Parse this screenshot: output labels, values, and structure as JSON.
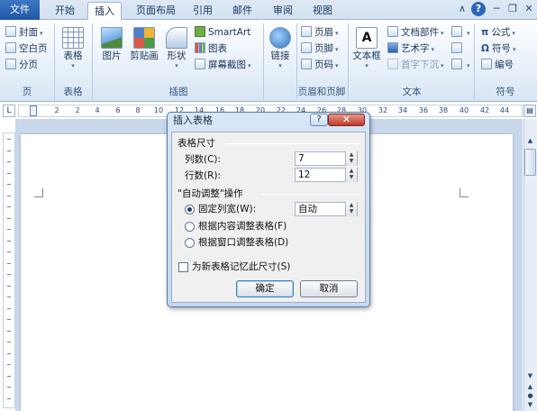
{
  "tabs": {
    "file": "文件",
    "home": "开始",
    "insert": "插入",
    "page_layout": "页面布局",
    "references": "引用",
    "mailings": "邮件",
    "review": "审阅",
    "view": "视图"
  },
  "window_controls": {
    "collapse": "∧",
    "help": "?",
    "minimize": "─",
    "restore": "❐",
    "close": "✕"
  },
  "ribbon": {
    "pages": {
      "label": "页",
      "cover": "封面",
      "blank_page": "空白页",
      "page_break": "分页"
    },
    "tables": {
      "label": "表格",
      "table": "表格"
    },
    "illustrations": {
      "label": "插图",
      "picture": "图片",
      "clip_art": "剪贴画",
      "shapes": "形状",
      "smartart": "SmartArt",
      "chart": "图表",
      "screenshot": "屏幕截图"
    },
    "links": {
      "link": "链接"
    },
    "header_footer": {
      "label": "页眉和页脚",
      "header": "页眉",
      "footer": "页脚",
      "page_number": "页码"
    },
    "text": {
      "label": "文本",
      "textbox": "文本框",
      "quick_parts": "文档部件",
      "wordart": "艺术字",
      "drop_cap": "首字下沉"
    },
    "symbols": {
      "label": "符号",
      "equation": "公式",
      "symbol": "符号",
      "number": "编号",
      "equation_glyph": "π",
      "symbol_glyph": "Ω"
    }
  },
  "ruler": {
    "corner": "L",
    "ticks": [
      "2",
      "2",
      "4",
      "6",
      "8",
      "10",
      "12",
      "14",
      "16",
      "18",
      "20",
      "22",
      "24",
      "26",
      "28",
      "30",
      "32",
      "34",
      "36",
      "38",
      "40",
      "42",
      "44"
    ]
  },
  "dialog": {
    "title": "插入表格",
    "help": "?",
    "close": "✕",
    "size_group": "表格尺寸",
    "columns_label": "列数(C):",
    "columns_value": "7",
    "rows_label": "行数(R):",
    "rows_value": "12",
    "autofit_group": "\"自动调整\"操作",
    "fixed_width_label": "固定列宽(W):",
    "fixed_width_value": "自动",
    "autofit_contents": "根据内容调整表格(F)",
    "autofit_window": "根据窗口调整表格(D)",
    "remember": "为新表格记忆此尺寸(S)",
    "ok": "确定",
    "cancel": "取消",
    "selected_option": "fixed_width",
    "remember_checked": false
  },
  "colors": {
    "file_tab": "#2b63b2",
    "ribbon_bg": "#e3edf8",
    "workspace": "#c9d7ea",
    "close_button": "#c0392b"
  }
}
